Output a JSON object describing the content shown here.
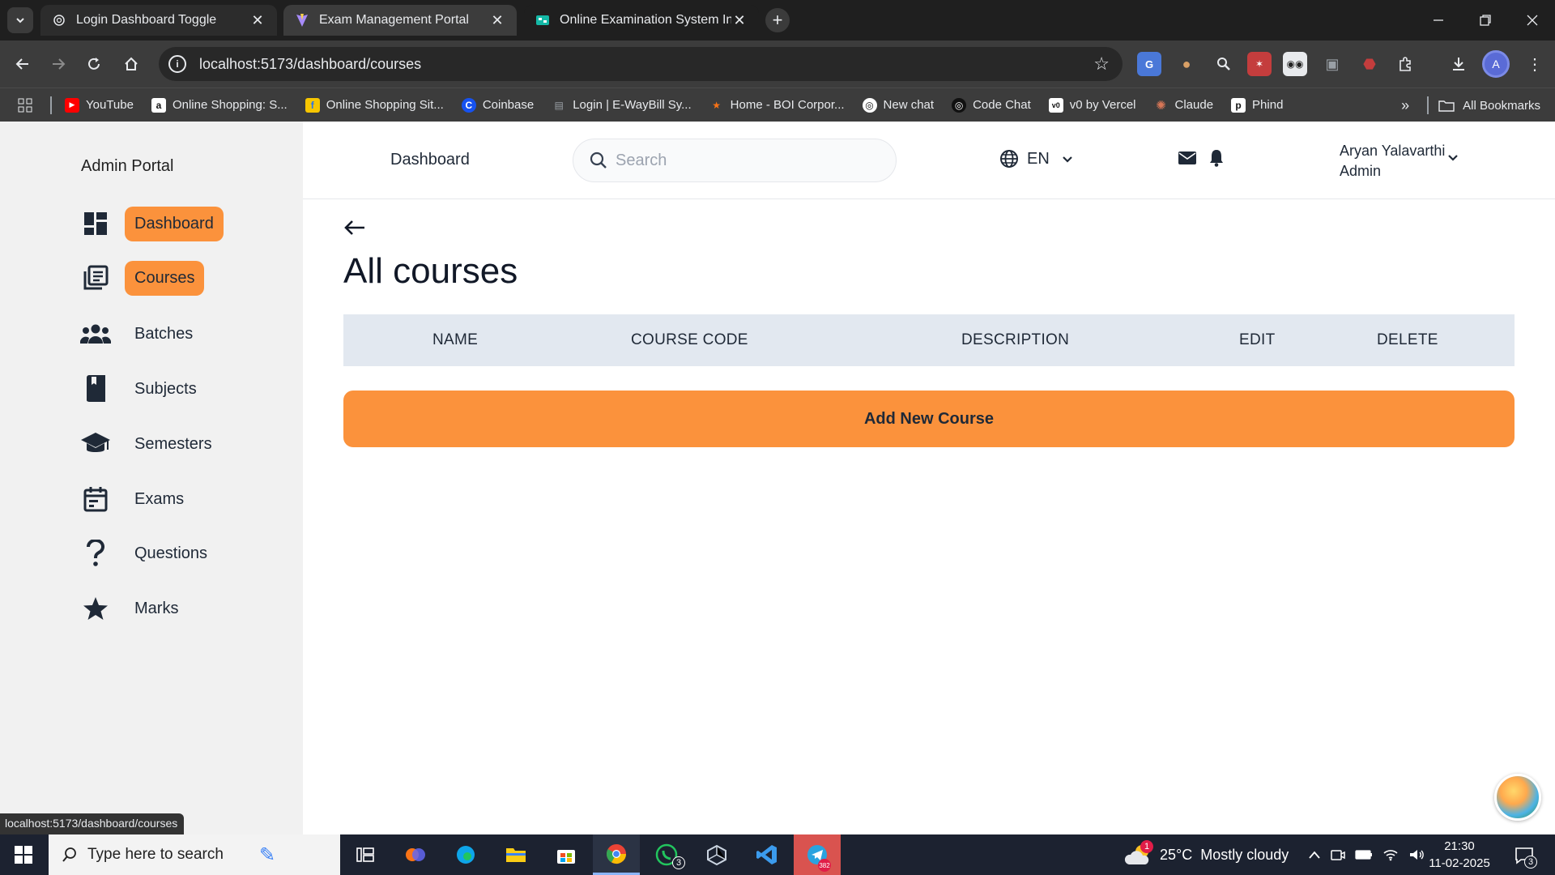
{
  "browser": {
    "tabs": [
      {
        "title": "Login Dashboard Toggle",
        "icon": "openai-icon"
      },
      {
        "title": "Exam Management Portal",
        "icon": "vite-icon"
      },
      {
        "title": "Online Examination System Insi",
        "icon": "diagram-icon"
      }
    ],
    "url": "localhost:5173/dashboard/courses",
    "bookmarks": [
      {
        "label": "YouTube",
        "icon": "youtube-icon"
      },
      {
        "label": "Online Shopping: S...",
        "icon": "amazon-icon"
      },
      {
        "label": "Online Shopping Sit...",
        "icon": "flipkart-icon"
      },
      {
        "label": "Coinbase",
        "icon": "coinbase-icon"
      },
      {
        "label": "Login | E-WayBill Sy...",
        "icon": "ewaybill-icon"
      },
      {
        "label": "Home - BOI Corpor...",
        "icon": "boi-icon"
      },
      {
        "label": "New chat",
        "icon": "openai-icon"
      },
      {
        "label": "Code Chat",
        "icon": "codechat-icon"
      },
      {
        "label": "v0 by Vercel",
        "icon": "v0-icon"
      },
      {
        "label": "Claude",
        "icon": "claude-icon"
      },
      {
        "label": "Phind",
        "icon": "phind-icon"
      }
    ],
    "all_bookmarks": "All Bookmarks",
    "profile_initial": "A",
    "status_url": "localhost:5173/dashboard/courses"
  },
  "sidebar": {
    "brand": "Admin Portal",
    "items": [
      {
        "label": "Dashboard",
        "icon": "dashboard-icon",
        "active": true
      },
      {
        "label": "Courses",
        "icon": "courses-icon",
        "active": true
      },
      {
        "label": "Batches",
        "icon": "batches-icon",
        "active": false
      },
      {
        "label": "Subjects",
        "icon": "subjects-icon",
        "active": false
      },
      {
        "label": "Semesters",
        "icon": "semesters-icon",
        "active": false
      },
      {
        "label": "Exams",
        "icon": "exams-icon",
        "active": false
      },
      {
        "label": "Questions",
        "icon": "questions-icon",
        "active": false
      },
      {
        "label": "Marks",
        "icon": "marks-icon",
        "active": false
      }
    ]
  },
  "topbar": {
    "title": "Dashboard",
    "search_placeholder": "Search",
    "language": "EN",
    "user_name": "Aryan Yalavarthi",
    "user_role": "Admin"
  },
  "main": {
    "title": "All courses",
    "columns": [
      "NAME",
      "COURSE CODE",
      "DESCRIPTION",
      "EDIT",
      "DELETE"
    ],
    "add_button": "Add New Course"
  },
  "taskbar": {
    "search_placeholder": "Type here to search",
    "whatsapp_badge": "3",
    "telegram_badge": "382",
    "weather_badge": "1",
    "temperature": "25°C",
    "weather": "Mostly cloudy",
    "time": "21:30",
    "date": "11-02-2025",
    "notification_count": "3"
  },
  "colors": {
    "accent": "#fb923c",
    "sidebar_bg": "#f1f1f1",
    "table_header_bg": "#e2e8f0"
  }
}
